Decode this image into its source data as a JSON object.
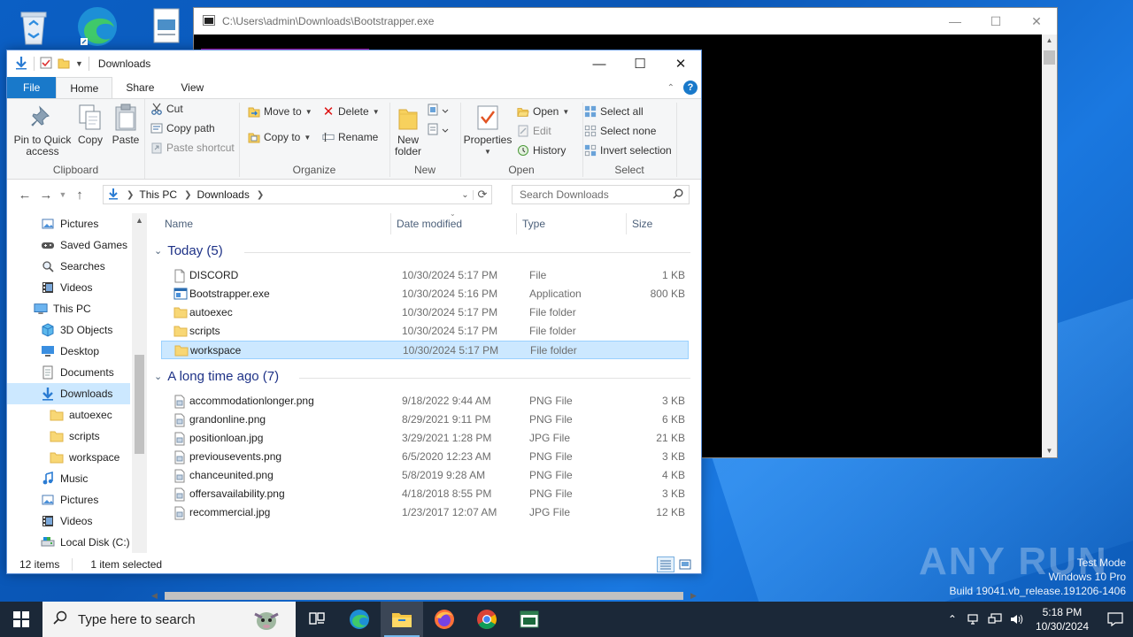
{
  "console": {
    "title": "C:\\Users\\admin\\Downloads\\Bootstrapper.exe"
  },
  "explorer": {
    "title": "Downloads",
    "tabs": [
      "File",
      "Home",
      "Share",
      "View"
    ],
    "ribbon": {
      "clipboard": {
        "pin_label": "Pin to Quick access",
        "copy_label": "Copy",
        "paste_label": "Paste",
        "cut_label": "Cut",
        "copy_path_label": "Copy path",
        "paste_shortcut_label": "Paste shortcut",
        "group_label": "Clipboard"
      },
      "organize": {
        "move_to_label": "Move to",
        "copy_to_label": "Copy to",
        "delete_label": "Delete",
        "rename_label": "Rename",
        "group_label": "Organize"
      },
      "new": {
        "new_folder_label": "New folder",
        "group_label": "New"
      },
      "open": {
        "properties_label": "Properties",
        "open_label": "Open",
        "edit_label": "Edit",
        "history_label": "History",
        "group_label": "Open"
      },
      "select": {
        "select_all_label": "Select all",
        "select_none_label": "Select none",
        "invert_label": "Invert selection",
        "group_label": "Select"
      }
    },
    "address": {
      "crumbs": [
        "This PC",
        "Downloads"
      ],
      "search_placeholder": "Search Downloads"
    },
    "nav": [
      {
        "label": "Pictures",
        "icon": "pictures-icon",
        "indent": 1
      },
      {
        "label": "Saved Games",
        "icon": "saved-games-icon",
        "indent": 1
      },
      {
        "label": "Searches",
        "icon": "searches-icon",
        "indent": 1
      },
      {
        "label": "Videos",
        "icon": "videos-icon",
        "indent": 1
      },
      {
        "label": "This PC",
        "icon": "this-pc-icon",
        "indent": 0
      },
      {
        "label": "3D Objects",
        "icon": "3d-objects-icon",
        "indent": 1
      },
      {
        "label": "Desktop",
        "icon": "desktop-icon",
        "indent": 1
      },
      {
        "label": "Documents",
        "icon": "documents-icon",
        "indent": 1
      },
      {
        "label": "Downloads",
        "icon": "downloads-icon",
        "indent": 1,
        "selected": true
      },
      {
        "label": "autoexec",
        "icon": "folder-icon",
        "indent": 2
      },
      {
        "label": "scripts",
        "icon": "folder-icon",
        "indent": 2
      },
      {
        "label": "workspace",
        "icon": "folder-icon",
        "indent": 2
      },
      {
        "label": "Music",
        "icon": "music-icon",
        "indent": 1
      },
      {
        "label": "Pictures",
        "icon": "pictures-icon",
        "indent": 1
      },
      {
        "label": "Videos",
        "icon": "videos-icon",
        "indent": 1
      },
      {
        "label": "Local Disk (C:)",
        "icon": "local-disk-icon",
        "indent": 1
      }
    ],
    "columns": {
      "name": "Name",
      "date": "Date modified",
      "type": "Type",
      "size": "Size"
    },
    "groups": [
      {
        "label": "Today (5)",
        "files": [
          {
            "name": "DISCORD",
            "date": "10/30/2024 5:17 PM",
            "type": "File",
            "size": "1 KB",
            "icon": "file-icon"
          },
          {
            "name": "Bootstrapper.exe",
            "date": "10/30/2024 5:16 PM",
            "type": "Application",
            "size": "800 KB",
            "icon": "application-icon"
          },
          {
            "name": "autoexec",
            "date": "10/30/2024 5:17 PM",
            "type": "File folder",
            "size": "",
            "icon": "folder-icon"
          },
          {
            "name": "scripts",
            "date": "10/30/2024 5:17 PM",
            "type": "File folder",
            "size": "",
            "icon": "folder-icon"
          },
          {
            "name": "workspace",
            "date": "10/30/2024 5:17 PM",
            "type": "File folder",
            "size": "",
            "icon": "folder-icon",
            "selected": true
          }
        ]
      },
      {
        "label": "A long time ago (7)",
        "files": [
          {
            "name": "accommodationlonger.png",
            "date": "9/18/2022 9:44 AM",
            "type": "PNG File",
            "size": "3 KB",
            "icon": "image-file-icon"
          },
          {
            "name": "grandonline.png",
            "date": "8/29/2021 9:11 PM",
            "type": "PNG File",
            "size": "6 KB",
            "icon": "image-file-icon"
          },
          {
            "name": "positionloan.jpg",
            "date": "3/29/2021 1:28 PM",
            "type": "JPG File",
            "size": "21 KB",
            "icon": "image-file-icon"
          },
          {
            "name": "previousevents.png",
            "date": "6/5/2020 12:23 AM",
            "type": "PNG File",
            "size": "3 KB",
            "icon": "image-file-icon"
          },
          {
            "name": "chanceunited.png",
            "date": "5/8/2019 9:28 AM",
            "type": "PNG File",
            "size": "4 KB",
            "icon": "image-file-icon"
          },
          {
            "name": "offersavailability.png",
            "date": "4/18/2018 8:55 PM",
            "type": "PNG File",
            "size": "3 KB",
            "icon": "image-file-icon"
          },
          {
            "name": "recommercial.jpg",
            "date": "1/23/2017 12:07 AM",
            "type": "JPG File",
            "size": "12 KB",
            "icon": "image-file-icon"
          }
        ]
      }
    ],
    "status": {
      "items": "12 items",
      "selected": "1 item selected"
    }
  },
  "watermark": {
    "brand": "ANY RUN",
    "line1": "Test Mode",
    "line2": "Windows 10 Pro",
    "line3": "Build 19041.vb_release.191206-1406"
  },
  "taskbar": {
    "search_placeholder": "Type here to search",
    "time": "5:18 PM",
    "date": "10/30/2024"
  },
  "colors": {
    "accent": "#1979ca",
    "selection": "#cce8ff",
    "taskbar": "#1b2838",
    "group_header": "#1e3287"
  }
}
